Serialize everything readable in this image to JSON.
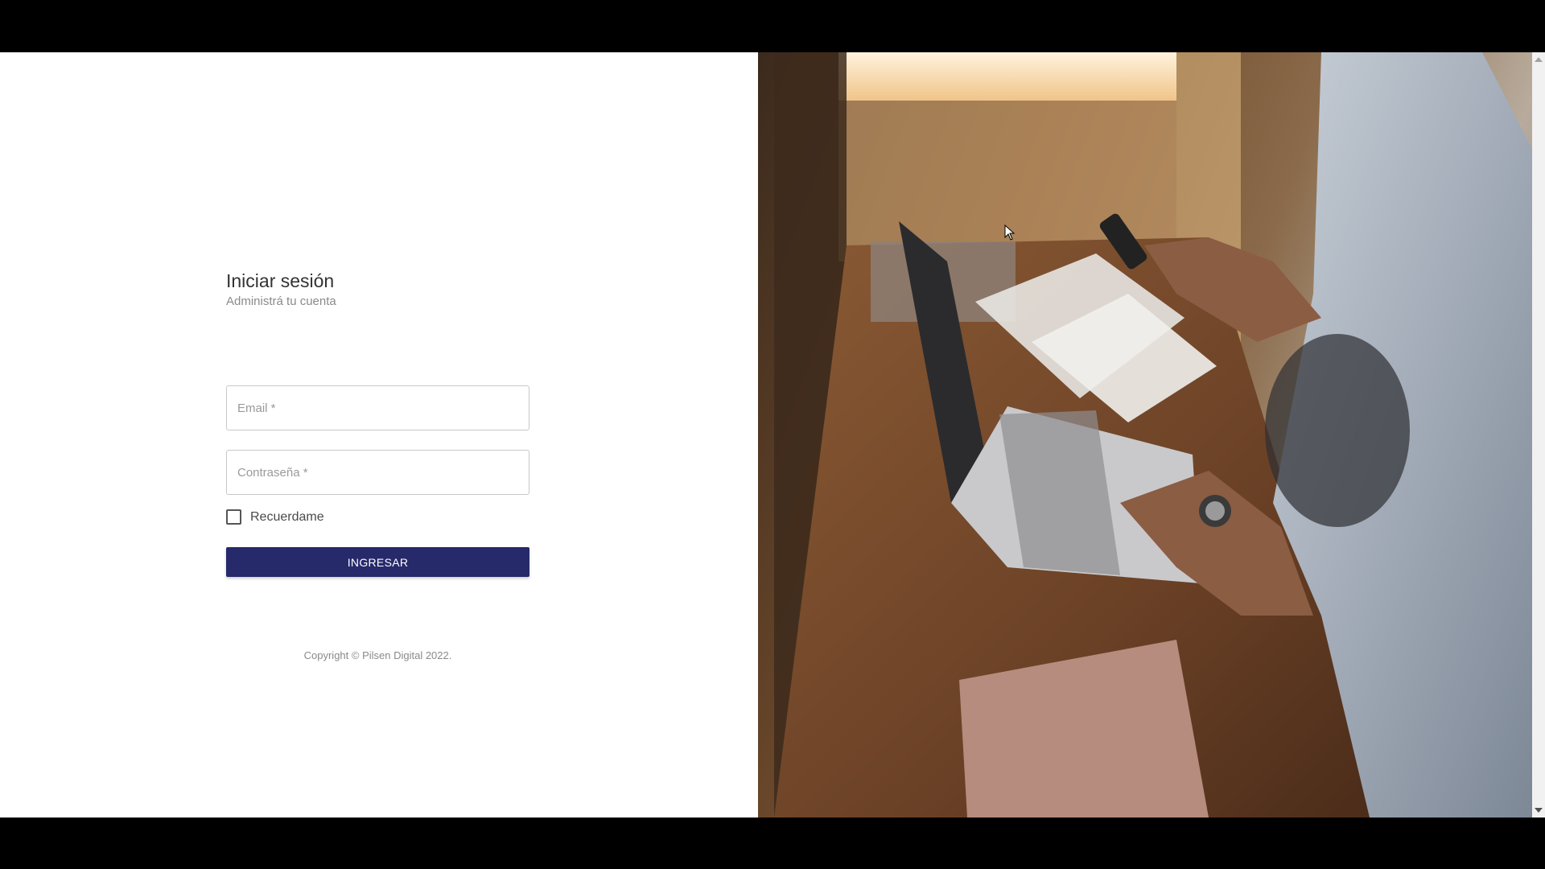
{
  "login": {
    "title": "Iniciar sesión",
    "subtitle": "Administrá tu cuenta",
    "email_placeholder": "Email *",
    "password_placeholder": "Contraseña *",
    "remember_label": "Recuerdame",
    "remember_checked": false,
    "submit_label": "INGRESAR",
    "copyright": "Copyright © Pilsen Digital 2022."
  },
  "colors": {
    "primary_button": "#262a6b",
    "field_border": "#c8c8c8",
    "background": "#ffffff"
  },
  "icons": {
    "cursor": "mouse-pointer-icon",
    "scroll_up": "scroll-up-arrow-icon",
    "scroll_down": "scroll-down-arrow-icon"
  }
}
